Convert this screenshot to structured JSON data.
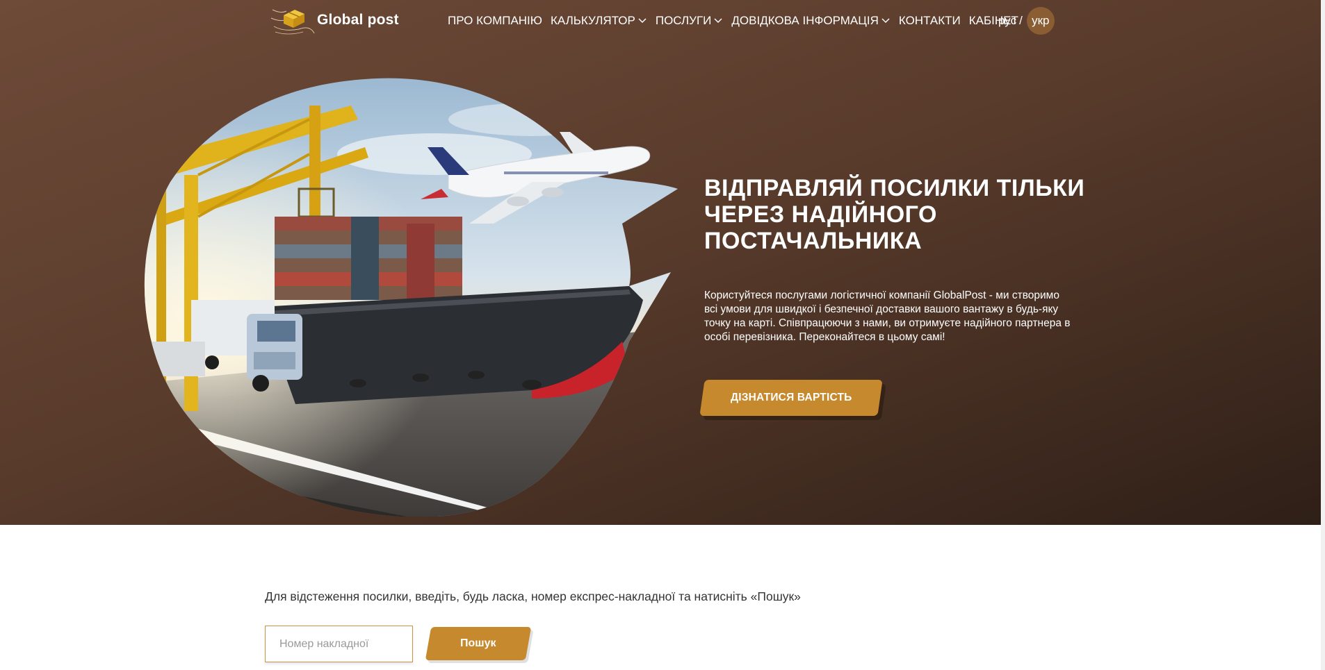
{
  "brand": {
    "name": "Global post"
  },
  "nav": {
    "items": [
      {
        "label": "ПРО КОМПАНІЮ",
        "has_dropdown": false
      },
      {
        "label": "КАЛЬКУЛЯТОР",
        "has_dropdown": true
      },
      {
        "label": "ПОСЛУГИ",
        "has_dropdown": true
      },
      {
        "label": "ДОВІДКОВА ІНФОРМАЦІЯ",
        "has_dropdown": true
      },
      {
        "label": "КОНТАКТИ",
        "has_dropdown": false
      },
      {
        "label": "КАБІНЕТ",
        "has_dropdown": false
      }
    ]
  },
  "language": {
    "ru": "рус",
    "separator": "/",
    "ua": "укр",
    "active": "укр"
  },
  "hero": {
    "title": "ВІДПРАВЛЯЙ ПОСИЛКИ ТІЛЬКИ ЧЕРЕЗ НАДІЙНОГО ПОСТАЧАЛЬНИКА",
    "description": "Користуйтеся послугами логістичної компанії GlobalPost - ми створимо всі умови для швидкої і безпечної доставки вашого вантажу в будь-яку точку на карті. Співпрацюючи з нами, ви отримуєте надійного партнера в особі перевізника. Переконайтеся в цьому самі!",
    "cta_label": "ДІЗНАТИСЯ ВАРТІСТЬ",
    "image_icon": "logistics-cargo-image"
  },
  "tracking": {
    "hint": "Для відстеження посилки, введіть, будь ласка, номер експрес-накладної та натисніть «Пошук»",
    "input_placeholder": "Номер накладної",
    "input_value": "",
    "search_label": "Пошук"
  },
  "colors": {
    "accent": "#c6892d",
    "hero_bg_top": "#6e4a38",
    "hero_bg_bottom": "#2e1f17",
    "lang_active_bg": "#8a5d33"
  }
}
